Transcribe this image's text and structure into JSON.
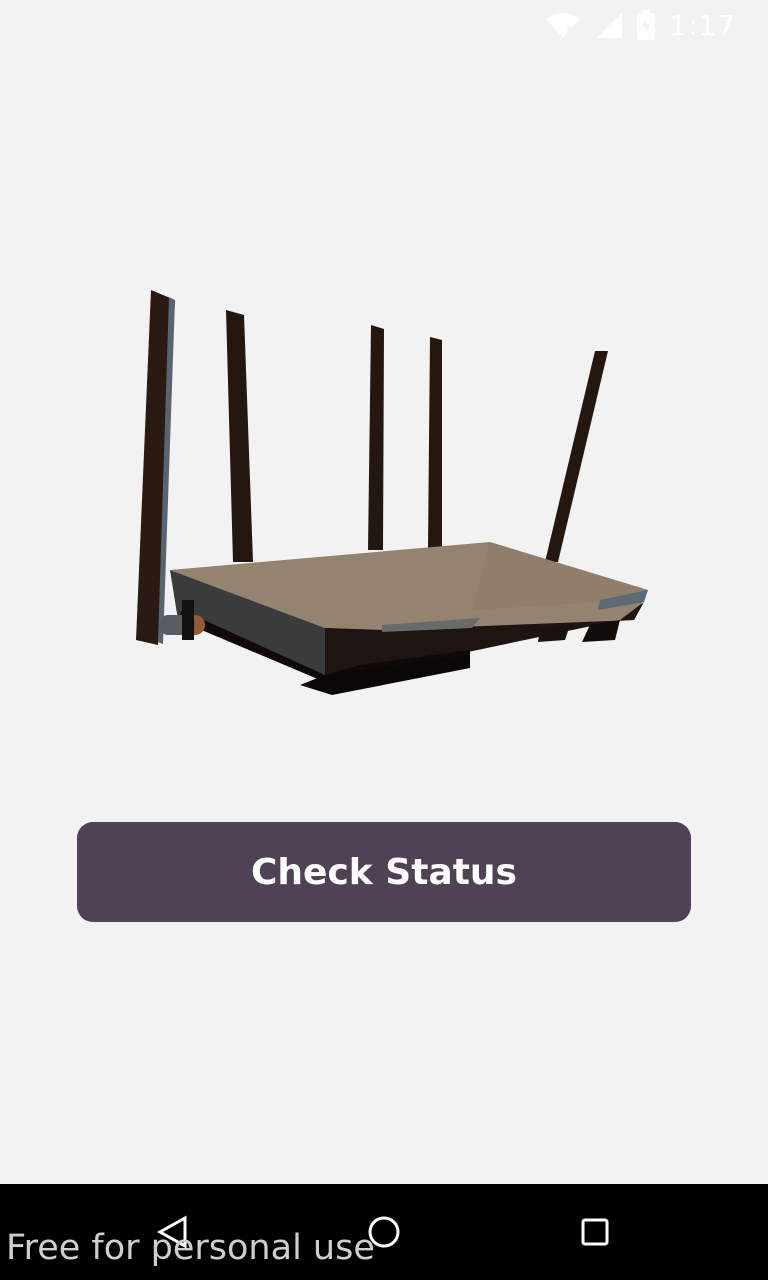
{
  "status_bar": {
    "time": "1:17",
    "icons": [
      "wifi-icon",
      "signal-icon",
      "battery-charging-icon"
    ]
  },
  "main": {
    "illustration": "router-image",
    "check_button_label": "Check Status",
    "accent_color": "#4e4254"
  },
  "nav_bar": {
    "buttons": [
      "back-icon",
      "home-icon",
      "recents-icon"
    ]
  },
  "watermark": "Free for personal use"
}
